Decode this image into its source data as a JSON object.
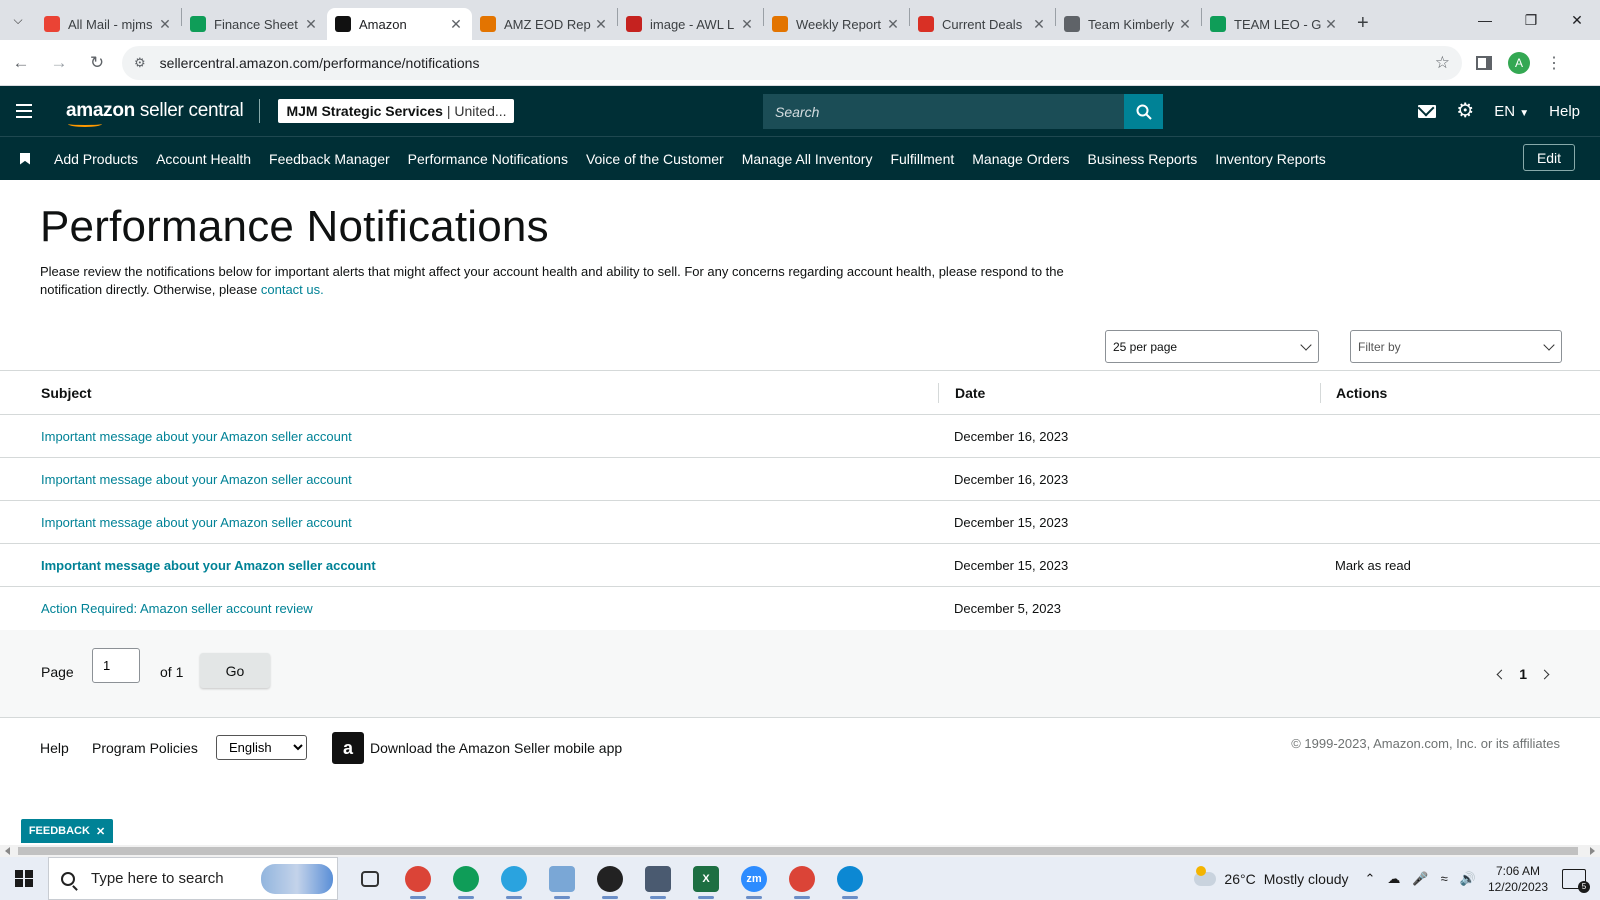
{
  "browser": {
    "tabs": [
      {
        "title": "All Mail - mjms",
        "favicon": "gmail-icon",
        "color": "#ea4335",
        "active": false
      },
      {
        "title": "Finance Sheet",
        "favicon": "sheets-icon",
        "color": "#0f9d58",
        "active": false
      },
      {
        "title": "Amazon",
        "favicon": "amazon-icon",
        "color": "#111111",
        "active": true
      },
      {
        "title": "AMZ EOD Rep",
        "favicon": "pen-icon",
        "color": "#e37400",
        "active": false
      },
      {
        "title": "image - AWL L",
        "favicon": "vivaldi-icon",
        "color": "#c5221f",
        "active": false
      },
      {
        "title": "Weekly Report",
        "favicon": "pen-icon",
        "color": "#e37400",
        "active": false
      },
      {
        "title": "Current Deals",
        "favicon": "deals-icon",
        "color": "#d93025",
        "active": false
      },
      {
        "title": "Team Kimberly",
        "favicon": "globe-icon",
        "color": "#5f6368",
        "active": false
      },
      {
        "title": "TEAM LEO - G",
        "favicon": "sheets-icon",
        "color": "#0f9d58",
        "active": false
      }
    ],
    "url": "sellercentral.amazon.com/performance/notifications",
    "profile_initial": "A"
  },
  "header": {
    "logo_bold": "amazon",
    "logo_light": " seller central",
    "account_name": "MJM Strategic Services",
    "marketplace": "| United...",
    "search_placeholder": "Search",
    "language": "EN",
    "help": "Help"
  },
  "nav": {
    "items": [
      "Add Products",
      "Account Health",
      "Feedback Manager",
      "Performance Notifications",
      "Voice of the Customer",
      "Manage All Inventory",
      "Fulfillment",
      "Manage Orders",
      "Business Reports",
      "Inventory Reports"
    ],
    "edit": "Edit"
  },
  "main": {
    "title": "Performance Notifications",
    "description": "Please review the notifications below for important alerts that might affect your account health and ability to sell. For any concerns regarding account health, please respond to the notification directly. Otherwise, please ",
    "contact_link": "contact us.",
    "per_page": "25 per page",
    "filter_placeholder": "Filter by"
  },
  "table": {
    "headers": {
      "subject": "Subject",
      "date": "Date",
      "actions": "Actions"
    },
    "rows": [
      {
        "subject": "Important message about your Amazon seller account",
        "date": "December 16, 2023",
        "action": "",
        "unread": false
      },
      {
        "subject": "Important message about your Amazon seller account",
        "date": "December 16, 2023",
        "action": "",
        "unread": false
      },
      {
        "subject": "Important message about your Amazon seller account",
        "date": "December 15, 2023",
        "action": "",
        "unread": false
      },
      {
        "subject": "Important message about your Amazon seller account",
        "date": "December 15, 2023",
        "action": "Mark as read",
        "unread": true
      },
      {
        "subject": "Action Required: Amazon seller account review",
        "date": "December 5, 2023",
        "action": "",
        "unread": false
      }
    ]
  },
  "pager": {
    "page_label": "Page",
    "page_value": "1",
    "of_label": "of 1",
    "go": "Go",
    "current": "1"
  },
  "footer": {
    "help": "Help",
    "policies": "Program Policies",
    "language": "English",
    "download": "Download the Amazon Seller mobile app",
    "copyright": "© 1999-2023, Amazon.com, Inc. or its affiliates",
    "feedback": "FEEDBACK"
  },
  "taskbar": {
    "search_placeholder": "Type here to search",
    "weather_temp": "26°C",
    "weather_desc": "Mostly cloudy",
    "time": "7:06 AM",
    "date": "12/20/2023",
    "notif_count": "5",
    "apps": [
      {
        "name": "task-view-icon",
        "label": "",
        "color": "#333333"
      },
      {
        "name": "chrome-icon",
        "label": "",
        "color": "#db4437"
      },
      {
        "name": "chrome-profile-icon",
        "label": "",
        "color": "#0f9d58"
      },
      {
        "name": "telegram-icon",
        "label": "",
        "color": "#2aa3df"
      },
      {
        "name": "files-icon",
        "label": "",
        "color": "#7aa7d6"
      },
      {
        "name": "record-icon",
        "label": "",
        "color": "#222222"
      },
      {
        "name": "calculator-icon",
        "label": "",
        "color": "#4a5a70"
      },
      {
        "name": "excel-icon",
        "label": "X",
        "color": "#1d6f42"
      },
      {
        "name": "zoom-icon",
        "label": "zm",
        "color": "#2d8cff"
      },
      {
        "name": "chrome-icon",
        "label": "",
        "color": "#db4437"
      },
      {
        "name": "edge-icon",
        "label": "",
        "color": "#0c88d3"
      }
    ]
  }
}
